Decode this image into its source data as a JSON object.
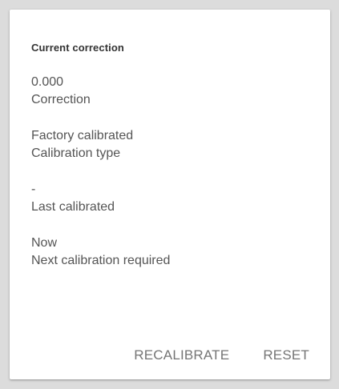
{
  "card": {
    "title": "Current correction",
    "entries": [
      {
        "value": "0.000",
        "label": "Correction"
      },
      {
        "value": "Factory calibrated",
        "label": "Calibration type"
      },
      {
        "value": "-",
        "label": "Last calibrated"
      },
      {
        "value": "Now",
        "label": "Next calibration required"
      }
    ],
    "actions": {
      "recalibrate_label": "RECALIBRATE",
      "reset_label": "RESET"
    }
  },
  "colors": {
    "background": "#dcdcdc",
    "card": "#ffffff",
    "text": "#555555",
    "button_text": "#757575"
  }
}
